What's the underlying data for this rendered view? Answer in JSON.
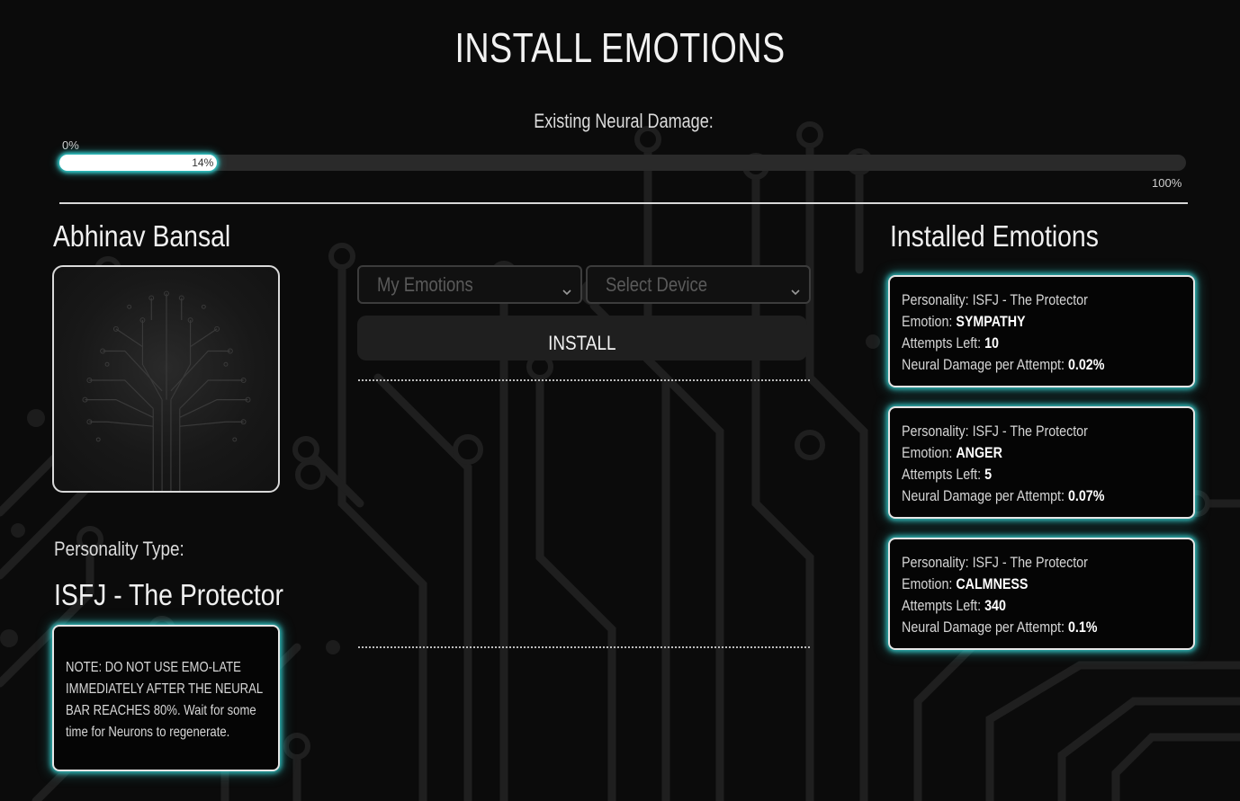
{
  "page": {
    "title": "INSTALL EMOTIONS"
  },
  "neural_damage": {
    "label": "Existing Neural Damage:",
    "min_label": "0%",
    "max_label": "100%",
    "value_label": "14%",
    "value": 14
  },
  "profile": {
    "name": "Abhinav Bansal",
    "avatar_icon": "circuit-tree-icon",
    "personality_label": "Personality Type:",
    "personality_value": "ISFJ - The Protector",
    "note": "NOTE: DO NOT USE EMO-LATE IMMEDIATELY AFTER THE NEURAL BAR REACHES 80%. Wait for some time for Neurons to regenerate."
  },
  "install_form": {
    "emotions_select": "My Emotions",
    "device_select": "Select Device",
    "install_label": "INSTALL",
    "chevron_icon": "chevron-down-icon"
  },
  "installed": {
    "title": "Installed Emotions",
    "field_labels": {
      "personality": "Personality: ",
      "emotion": "Emotion: ",
      "attempts": "Attempts Left: ",
      "damage": "Neural Damage per Attempt: "
    },
    "items": [
      {
        "personality": "ISFJ - The Protector",
        "emotion": "SYMPATHY",
        "attempts": "10",
        "damage": "0.02%"
      },
      {
        "personality": "ISFJ - The Protector",
        "emotion": "ANGER",
        "attempts": "5",
        "damage": "0.07%"
      },
      {
        "personality": "ISFJ - The Protector",
        "emotion": "CALMNESS",
        "attempts": "340",
        "damage": "0.1%"
      }
    ]
  },
  "colors": {
    "background": "#0b0b0b",
    "glow": "#36d6d6",
    "text": "#e8e8e8",
    "bar_track": "#2a2a2a"
  }
}
